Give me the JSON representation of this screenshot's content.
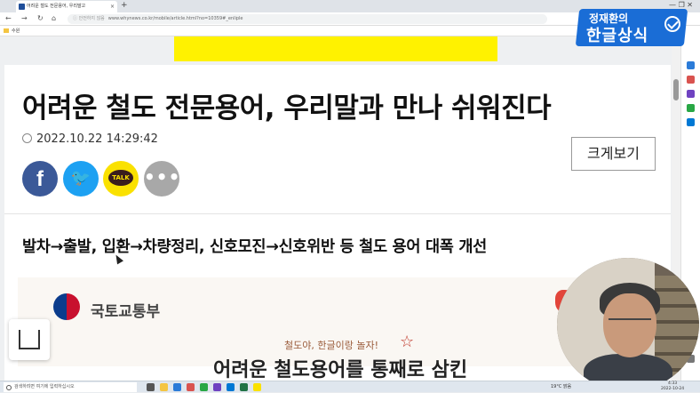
{
  "browser": {
    "tab_title": "어려운 철도 전문용어, 우리말고",
    "tab_close": "×",
    "new_tab": "+",
    "window_controls": "—  ❐  ✕",
    "url_warning": "ⓘ 안전하지 않음",
    "url": "www.whynews.co.kr/mobile/article.html?no=10359#_enliple",
    "bookmark_folder": "수원"
  },
  "article": {
    "headline": "어려운 철도 전문용어, 우리말과 만나 쉬워진다",
    "datetime": "2022.10.22 14:29:42",
    "enlarge_button": "크게보기",
    "share": {
      "facebook": "f",
      "twitter": "🐦",
      "kakao": "TALK",
      "more": "•••"
    },
    "subheadline": "발차→출발, 입환→차량정리, 신호모진→신호위반 등 철도 용어 대폭 개선"
  },
  "infographic": {
    "ministry": "국토교통부",
    "tagline": "철도야, 한글이랑 놀자!",
    "title": "어려운 철도용어를 통째로 삼킨"
  },
  "overlay_banner": {
    "small": "정재환의",
    "big": "한글상식"
  },
  "taskbar": {
    "search_placeholder": "검색하려면 여기에 입력하십시오",
    "weather": "19°C 맑음",
    "time": "4:33",
    "date": "2022-10-24"
  },
  "colors": {
    "facebook": "#3b5998",
    "twitter": "#1da1f2",
    "kakao": "#fae100",
    "ad_yellow": "#fff200",
    "banner_blue": "#1a6dd6"
  }
}
